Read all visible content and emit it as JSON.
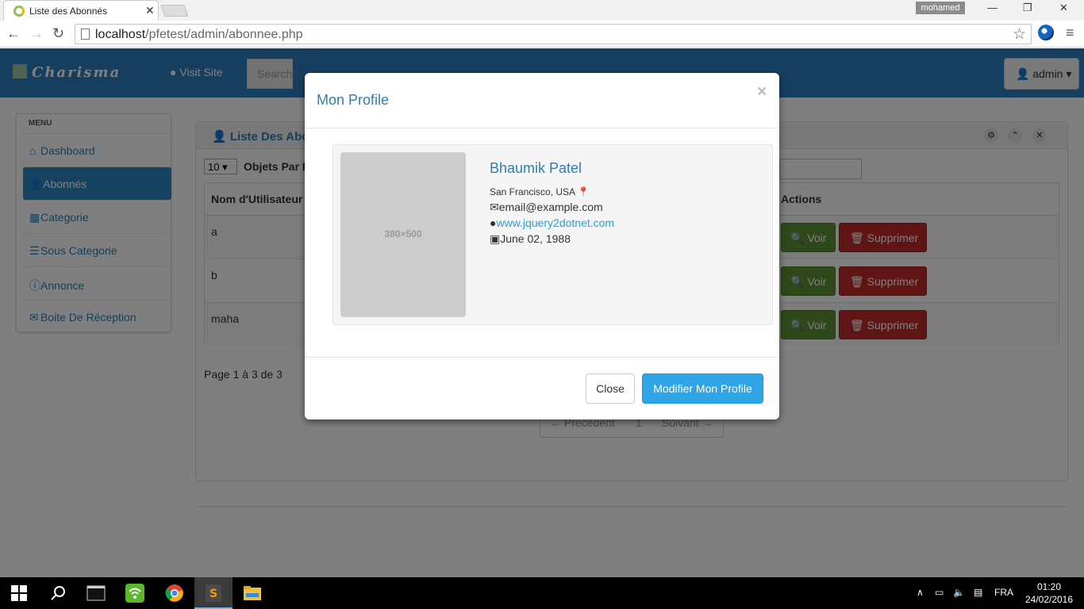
{
  "browser": {
    "tab_title": "Liste des Abonnés",
    "tab_close": "✕",
    "user_badge": "mohamed",
    "url_host": "localhost",
    "url_path": "/pfetest/admin/abonnee.php",
    "minimize": "—",
    "restore": "❐",
    "close": "✕"
  },
  "navbar": {
    "brand": "Charisma",
    "visit_site": "Visit Site",
    "search_placeholder": "Search",
    "user_menu": "admin"
  },
  "sidebar": {
    "heading": "MENU",
    "items": [
      {
        "label": "Dashboard",
        "icon": "home-icon"
      },
      {
        "label": "Abonnés",
        "icon": "user-icon",
        "active": true
      },
      {
        "label": "Categorie",
        "icon": "list-icon"
      },
      {
        "label": "Sous Categorie",
        "icon": "list-alt-icon"
      },
      {
        "label": "Annonce",
        "icon": "info-icon"
      },
      {
        "label": "Boite De Réception",
        "icon": "envelope-icon"
      }
    ]
  },
  "content": {
    "box_title": "Liste Des Abonnés",
    "per_page_value": "10",
    "per_page_label": "Objets Par Page",
    "columns": [
      "Nom d'Utilisateur",
      "Actions"
    ],
    "rows": [
      {
        "name": "a"
      },
      {
        "name": "b"
      },
      {
        "name": "maha"
      }
    ],
    "voir_label": "Voir",
    "supprimer_label": "Supprimer",
    "page_info": "Page 1 à 3 de 3",
    "pager": {
      "prev": "← Precedent",
      "page": "1",
      "next": "Suivant →"
    }
  },
  "modal": {
    "title": "Mon Profile",
    "close_x": "×",
    "image_placeholder": "380×500",
    "name": "Bhaumik Patel",
    "location": "San Francisco, USA",
    "email": "email@example.com",
    "website": "www.jquery2dotnet.com",
    "birthday": "June 02, 1988",
    "close_button": "Close",
    "modify_button": "Modifier Mon Profile"
  },
  "taskbar": {
    "lang": "FRA",
    "time": "01:20",
    "date": "24/02/2016"
  },
  "colors": {
    "navbar": "#2c7fbf",
    "primary_text": "#317eac",
    "btn_success": "#5f9135",
    "btn_danger": "#c02a2a",
    "btn_primary": "#2fa4e7"
  }
}
